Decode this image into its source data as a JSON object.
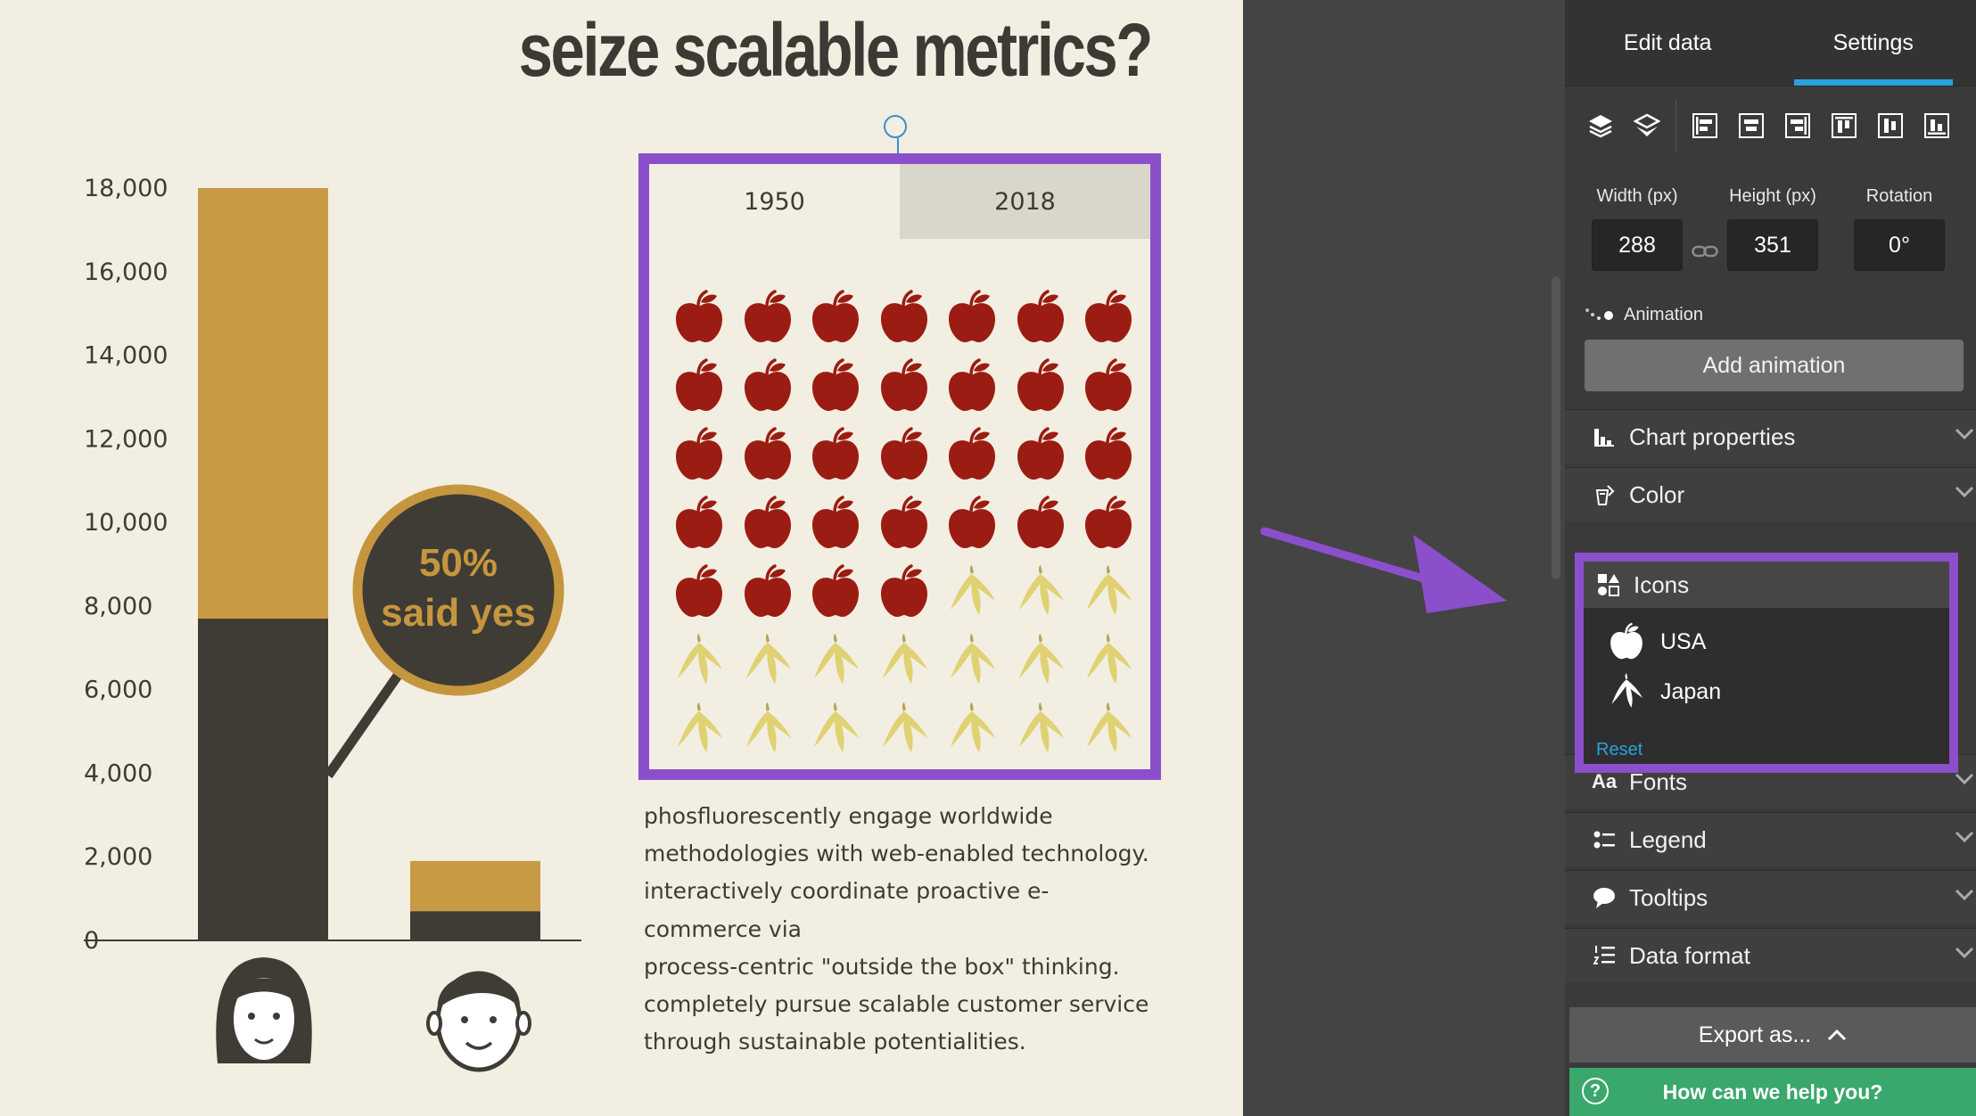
{
  "canvas": {
    "headline": "seize scalable metrics?",
    "bar_chart": {
      "type": "bar",
      "y_ticks": [
        "0",
        "2,000",
        "4,000",
        "6,000",
        "8,000",
        "10,000",
        "12,000",
        "14,000",
        "16,000",
        "18,000"
      ],
      "ylim": [
        0,
        18000
      ],
      "categories": [
        "woman",
        "man"
      ],
      "series": [
        {
          "values": [
            7700,
            700
          ],
          "color": "#3f3c35"
        },
        {
          "values": [
            10300,
            1200
          ],
          "color": "#c99a44"
        }
      ],
      "callout": {
        "line1": "50%",
        "line2": "said yes"
      }
    },
    "pictograph": {
      "tabs": [
        "1950",
        "2018"
      ],
      "active_tab": 0,
      "grid": {
        "columns": 7,
        "apples": 32,
        "bananas": 17
      },
      "colors": {
        "apple": "#9b1c12",
        "banana": "#e0d172"
      }
    },
    "body_text": [
      "phosfluorescently engage worldwide",
      "methodologies with web-enabled technology.",
      "interactively coordinate proactive e-commerce via",
      "process-centric \"outside the box\" thinking.",
      "completely pursue scalable customer service",
      "through sustainable potentialities."
    ]
  },
  "panel": {
    "tabs": [
      "Edit data",
      "Settings"
    ],
    "active_tab": 1,
    "dimensions": {
      "width_label": "Width (px)",
      "width_value": "288",
      "height_label": "Height (px)",
      "height_value": "351",
      "rotation_label": "Rotation",
      "rotation_value": "0°"
    },
    "animation": {
      "label": "Animation",
      "button": "Add animation"
    },
    "sections_top": [
      "Chart properties",
      "Color"
    ],
    "icons_section": {
      "title": "Icons",
      "items": [
        "USA",
        "Japan"
      ],
      "reset": "Reset"
    },
    "sections_bottom": [
      "Fonts",
      "Legend",
      "Tooltips",
      "Data format"
    ],
    "export_label": "Export as...",
    "help_label": "How can we help you?",
    "accent_color": "#2aa1df",
    "highlight_color": "#8c4fcc"
  }
}
